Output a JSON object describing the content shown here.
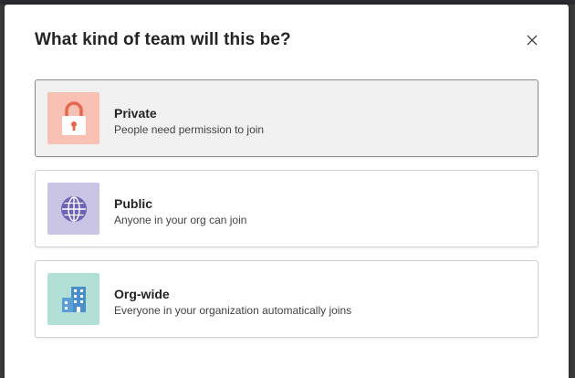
{
  "dialog": {
    "title": "What kind of team will this be?",
    "close_icon": "close-icon"
  },
  "options": [
    {
      "title": "Private",
      "description": "People need permission to join",
      "icon": "lock-icon",
      "tile_color": "#f9c0b4",
      "icon_color": "#e8664e",
      "selected": true
    },
    {
      "title": "Public",
      "description": "Anyone in your org can join",
      "icon": "globe-icon",
      "tile_color": "#c9c3e4",
      "icon_color": "#6b63b5",
      "selected": false
    },
    {
      "title": "Org-wide",
      "description": "Everyone in your organization automatically joins",
      "icon": "building-icon",
      "tile_color": "#b3e0d6",
      "icon_color": "#4a8fc7",
      "selected": false
    }
  ]
}
